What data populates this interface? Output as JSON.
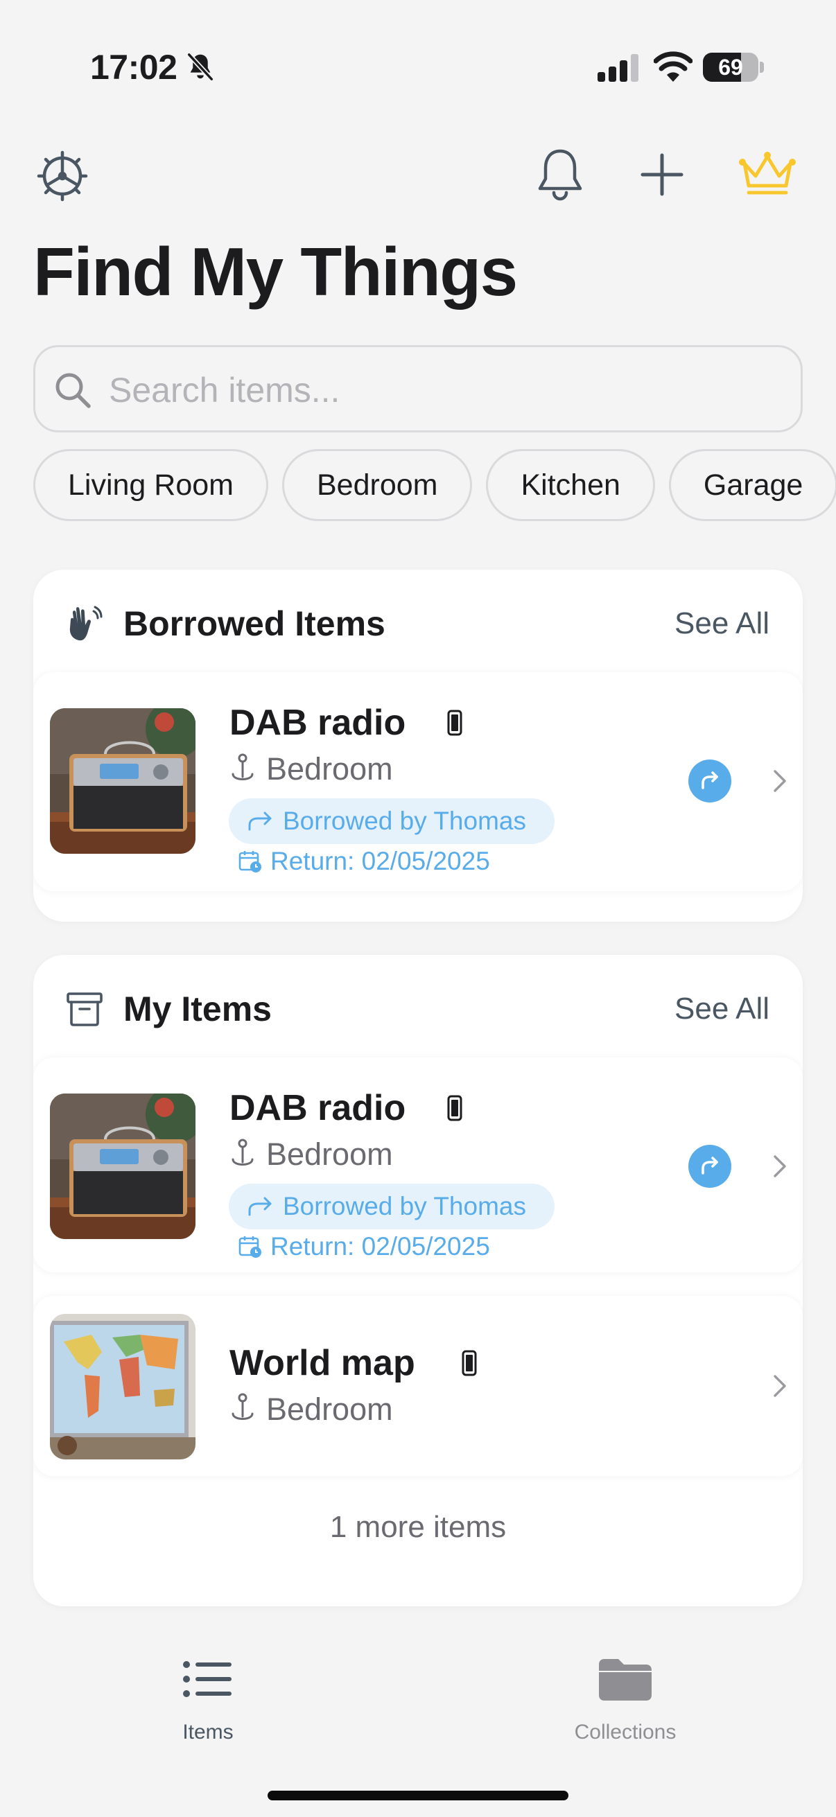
{
  "status_bar": {
    "time": "17:02",
    "battery": "69",
    "battery_level_percent": 69,
    "icons": [
      "bell-slash-icon",
      "cellular-signal-icon",
      "wifi-icon",
      "battery-icon"
    ]
  },
  "header": {
    "title": "Find My Things",
    "icons": [
      "settings-icon",
      "bell-icon",
      "plus-icon",
      "crown-icon"
    ],
    "crown_color": "#f8c72e"
  },
  "search": {
    "placeholder": "Search items...",
    "value": ""
  },
  "filters": [
    "Living Room",
    "Bedroom",
    "Kitchen",
    "Garage"
  ],
  "borrowed_section": {
    "title": "Borrowed Items",
    "see_all": "See All",
    "icon": "hand-wave-icon",
    "items": [
      {
        "name": "DAB radio",
        "location": "Bedroom",
        "status": "Borrowed by Thomas",
        "return": "Return: 02/05/2025"
      }
    ]
  },
  "my_items_section": {
    "title": "My Items",
    "see_all": "See All",
    "icon": "archive-box-icon",
    "items": [
      {
        "name": "DAB radio",
        "location": "Bedroom",
        "status": "Borrowed by Thomas",
        "return": "Return: 02/05/2025"
      },
      {
        "name": "World map",
        "location": "Bedroom"
      }
    ],
    "more": "1 more items"
  },
  "tab_bar": {
    "tabs": [
      {
        "label": "Items",
        "icon": "list-icon",
        "active": true
      },
      {
        "label": "Collections",
        "icon": "folder-icon",
        "active": false
      }
    ]
  },
  "colors": {
    "accent": "#59acea",
    "accent_bg": "#e5f2fc",
    "background": "#f4f4f5",
    "tab_active": "#4a5763",
    "tab_inactive": "#8e8e93"
  }
}
